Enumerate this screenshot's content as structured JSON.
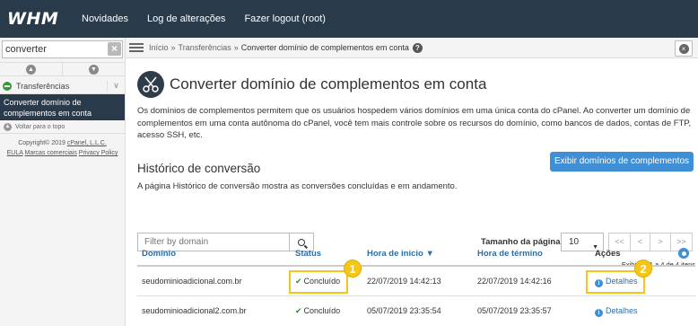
{
  "topbar": {
    "logo": "WHM",
    "nav": [
      "Novidades",
      "Log de alterações",
      "Fazer logout (root)"
    ]
  },
  "sidebar": {
    "search_value": "converter",
    "search_clear": "×",
    "category": "Transferências",
    "active_item": "Converter domínio de complementos em conta",
    "back_to_top": "Voltar para o topo",
    "footer": {
      "copyright": "Copyright© 2019",
      "company": "cPanel, L.L.C.",
      "links": [
        "EULA",
        "Marcas comerciais",
        "Privacy Policy"
      ]
    }
  },
  "breadcrumb": {
    "items": [
      "Início",
      "Transferências",
      "Converter domínio de complementos em conta"
    ],
    "separator": "»"
  },
  "page": {
    "title": "Converter domínio de complementos em conta",
    "description": "Os domínios de complementos permitem que os usuários hospedem vários domínios em uma única conta do cPanel. Ao converter um domínio de complementos em uma conta autônoma do cPanel, você tem mais controle sobre os recursos do domínio, como bancos de dados, contas de FTP, acesso SSH, etc.",
    "show_button": "Exibir domínios de complementos",
    "history_title": "Histórico de conversão",
    "history_subtitle": "A página Histórico de conversão mostra as conversões concluídas e em andamento.",
    "filter_placeholder": "Filter by domain",
    "page_size_label": "Tamanho da página",
    "page_size_value": "10",
    "pager": [
      "<<",
      "<",
      ">",
      ">>"
    ],
    "showing": "Exibindo 1 a 4 de 4 itens"
  },
  "table": {
    "headers": {
      "domain": "Domínio",
      "status": "Status",
      "start": "Hora de início ▼",
      "end": "Hora de término",
      "actions": "Ações"
    },
    "rows": [
      {
        "domain": "seudominioadicional.com.br",
        "status": "Concluído",
        "start": "22/07/2019 14:42:13",
        "end": "22/07/2019 14:42:16",
        "action": "Detalhes"
      },
      {
        "domain": "seudominioadicional2.com.br",
        "status": "Concluído",
        "start": "05/07/2019 23:35:54",
        "end": "05/07/2019 23:35:57",
        "action": "Detalhes"
      }
    ]
  },
  "annotations": [
    "1",
    "2"
  ],
  "colors": {
    "topbar": "#293a4a",
    "primary": "#3e8fd5",
    "highlight": "#f5c518",
    "success": "#3a8a3a"
  }
}
